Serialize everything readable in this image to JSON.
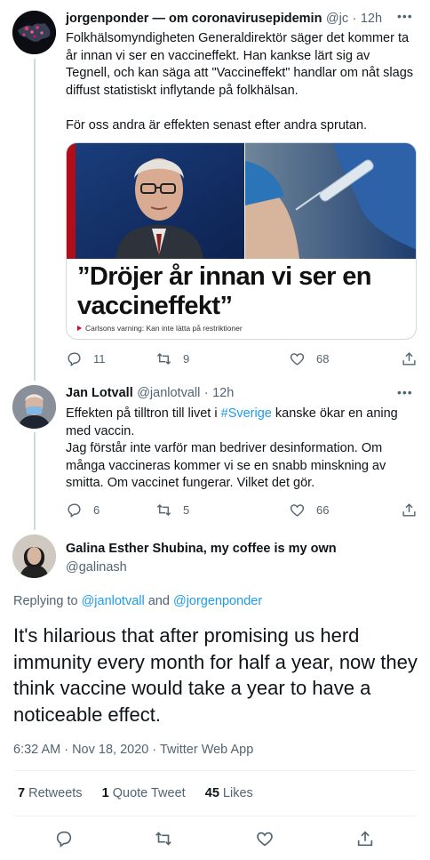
{
  "tweet1": {
    "name": "jorgenponder — om coronavirusepidemin",
    "handle": "@jc",
    "time": "12h",
    "text": "Folkhälsomyndigheten Generaldirektör säger det kommer ta år innan vi ser en vaccineffekt. Han kankse lärt sig av Tegnell, och kan säga att \"Vaccineffekt\" handlar om nåt slags diffust statistiskt inflytande på folkhälsan.\n\nFör oss andra är effekten senast efter andra sprutan.",
    "card": {
      "headline": "”Dröjer år innan vi ser en vaccineffekt”",
      "caption": "Carlsons varning: Kan inte lätta på restriktioner"
    },
    "replies": "11",
    "retweets": "9",
    "likes": "68"
  },
  "tweet2": {
    "name": "Jan Lotvall",
    "handle": "@janlotvall",
    "time": "12h",
    "text_before": "Effekten på tilltron till livet i ",
    "hashtag": "#Sverige",
    "text_after": " kanske ökar en aning med vaccin.\nJag förstår inte varför man bedriver desinformation. Om många vaccineras kommer vi se en snabb minskning av smitta. Om vaccinet fungerar. Vilket det gör.",
    "replies": "6",
    "retweets": "5",
    "likes": "66"
  },
  "main_tweet": {
    "name": "Galina Esther Shubina, my coffee is my own",
    "handle": "@galinash",
    "replying_label": "Replying to ",
    "reply_user1": "@janlotvall",
    "reply_and": " and ",
    "reply_user2": "@jorgenponder",
    "text": "It's hilarious that after promising us herd immunity every month for half a year, now they think vaccine would take a year to have a noticeable effect.",
    "timestamp": "6:32 AM · Nov 18, 2020 · Twitter Web App",
    "retweets_count": "7",
    "retweets_label": "Retweets",
    "quotes_count": "1",
    "quotes_label": "Quote Tweet",
    "likes_count": "45",
    "likes_label": "Likes"
  },
  "icons": [
    "reply-icon",
    "retweet-icon",
    "like-icon",
    "share-icon",
    "more-icon"
  ],
  "colors": {
    "link": "#1d9bf0",
    "secondary": "#536471",
    "divider": "#eff3f4",
    "card_red": "#e2001a"
  }
}
